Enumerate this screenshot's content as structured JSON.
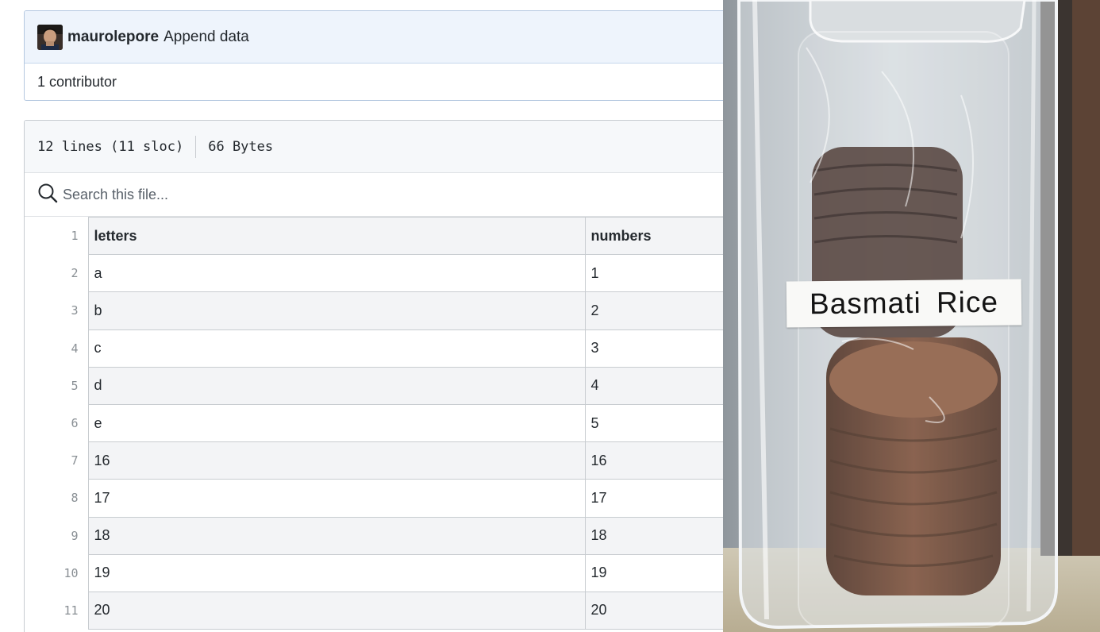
{
  "commit": {
    "author": "maurolepore",
    "message": "Append data",
    "contributors": "1 contributor",
    "avatar_icon": "user-avatar"
  },
  "file": {
    "lines": "12 lines (11 sloc)",
    "size": "66 Bytes",
    "search_placeholder": "Search this file..."
  },
  "table": {
    "headers": [
      "letters",
      "numbers"
    ],
    "rows": [
      [
        "a",
        "1"
      ],
      [
        "b",
        "2"
      ],
      [
        "c",
        "3"
      ],
      [
        "d",
        "4"
      ],
      [
        "e",
        "5"
      ],
      [
        "16",
        "16"
      ],
      [
        "17",
        "17"
      ],
      [
        "18",
        "18"
      ],
      [
        "19",
        "19"
      ],
      [
        "20",
        "20"
      ]
    ],
    "line_numbers": [
      "1",
      "2",
      "3",
      "4",
      "5",
      "6",
      "7",
      "8",
      "9",
      "10",
      "11"
    ]
  },
  "photo": {
    "label_text": "Basmati Rice"
  },
  "colors": {
    "header_bg": "#eef4fc",
    "row_alt_bg": "#f3f4f6",
    "border": "#c8ccd0"
  }
}
